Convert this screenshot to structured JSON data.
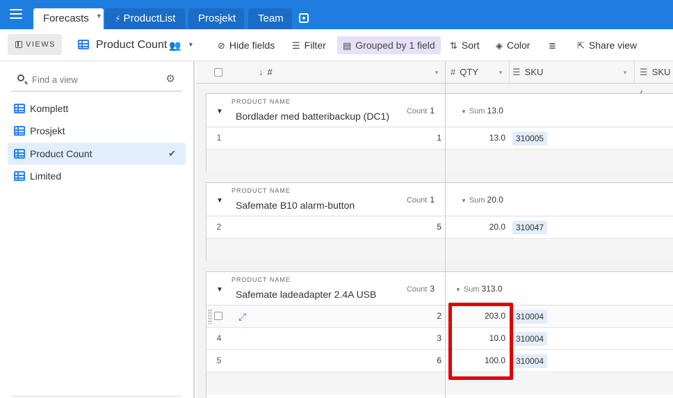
{
  "topbar": {
    "tabs": [
      {
        "label": "Forecasts",
        "active": true
      },
      {
        "label": "ProductList"
      },
      {
        "label": "Prosjekt"
      },
      {
        "label": "Team"
      }
    ]
  },
  "toolbar": {
    "views_label": "VIEWS",
    "view_name": "Product Count",
    "hide_fields": "Hide fields",
    "filter": "Filter",
    "grouped": "Grouped by 1 field",
    "sort": "Sort",
    "color": "Color",
    "share": "Share view"
  },
  "sidebar": {
    "search_placeholder": "Find a view",
    "items": [
      {
        "label": "Komplett"
      },
      {
        "label": "Prosjekt"
      },
      {
        "label": "Product Count",
        "selected": true
      },
      {
        "label": "Limited"
      }
    ]
  },
  "grid": {
    "columns": {
      "num": "#",
      "qty": "QTY",
      "sku": "SKU",
      "sku2": "SKU ("
    },
    "group_label": "PRODUCT NAME",
    "count_label": "Count",
    "sum_label": "Sum",
    "groups": [
      {
        "name": "Bordlader med batteribackup (DC1)",
        "count": "1",
        "sum": "13.0",
        "rows": [
          {
            "row": "1",
            "num": "1",
            "qty": "13.0",
            "sku": "310005"
          }
        ]
      },
      {
        "name": "Safemate B10 alarm-button",
        "count": "1",
        "sum": "20.0",
        "rows": [
          {
            "row": "2",
            "num": "5",
            "qty": "20.0",
            "sku": "310047"
          }
        ]
      },
      {
        "name": "Safemate ladeadapter 2.4A USB",
        "count": "3",
        "sum": "313.0",
        "rows": [
          {
            "row": "",
            "num": "2",
            "qty": "203.0",
            "sku": "310004"
          },
          {
            "row": "4",
            "num": "3",
            "qty": "10.0",
            "sku": "310004"
          },
          {
            "row": "5",
            "num": "6",
            "qty": "100.0",
            "sku": "310004"
          }
        ]
      }
    ]
  },
  "colors": {
    "accent": "#1f7de0",
    "highlight": "#e00000",
    "selected": "#e1effd"
  }
}
